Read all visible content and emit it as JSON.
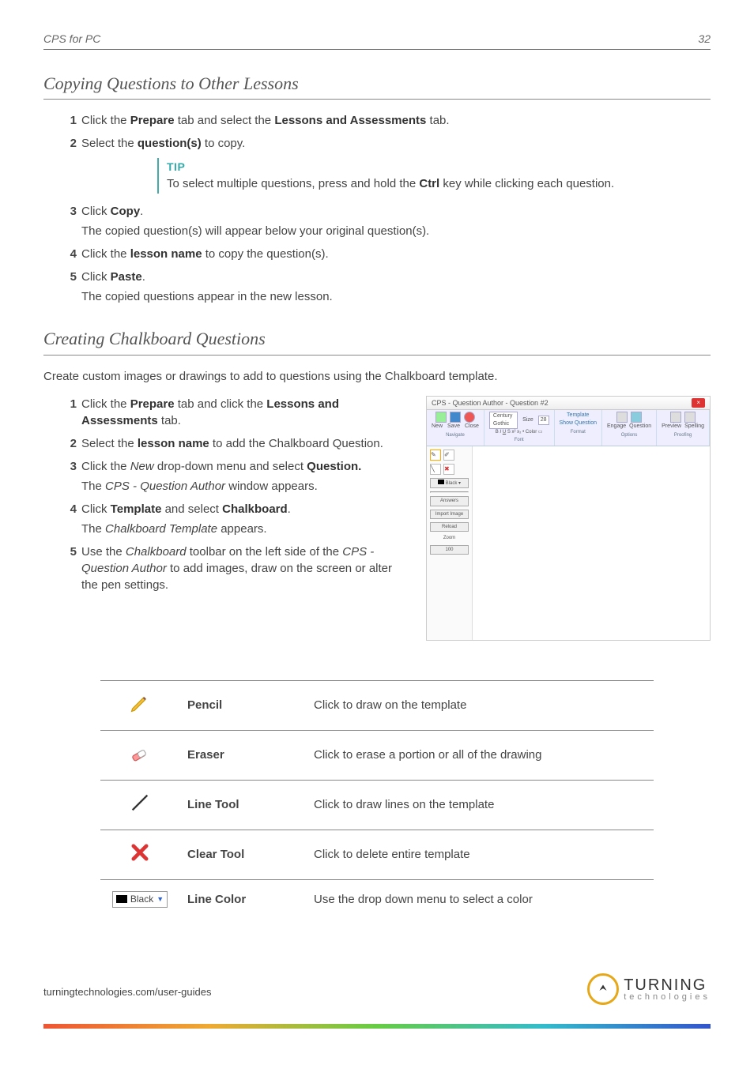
{
  "header": {
    "doc_title": "CPS for PC",
    "page_num": "32"
  },
  "section1": {
    "title": "Copying Questions to Other Lessons",
    "steps": [
      {
        "num": "1",
        "html": "Click the <b>Prepare</b> tab and select the <b>Lessons and Assessments</b> tab."
      },
      {
        "num": "2",
        "html": "Select the <b>question(s)</b> to copy."
      },
      {
        "num": "3",
        "html": "Click <b>Copy</b>.",
        "sub": "The copied question(s) will appear below your original question(s)."
      },
      {
        "num": "4",
        "html": "Click the <b>lesson name</b> to copy the question(s)."
      },
      {
        "num": "5",
        "html": "Click <b>Paste</b>.",
        "sub": "The copied questions appear in the new lesson."
      }
    ],
    "tip": {
      "title": "TIP",
      "html": "To select multiple questions, press and hold the <b>Ctrl</b> key while clicking each question."
    }
  },
  "section2": {
    "title": "Creating Chalkboard Questions",
    "intro": "Create custom images or drawings to add to questions using the Chalkboard template.",
    "steps": [
      {
        "num": "1",
        "html": "Click the <b>Prepare</b> tab and click the <b>Lessons and Assessments</b> tab."
      },
      {
        "num": "2",
        "html": "Select the <b>lesson name</b> to add the Chalkboard Question."
      },
      {
        "num": "3",
        "html": "Click the <em>New</em> drop-down menu and select <b>Question.</b>",
        "sub": "The <em>CPS - Question Author</em> window appears."
      },
      {
        "num": "4",
        "html": "Click <b>Template</b> and select <b>Chalkboard</b>.",
        "sub": "The <em>Chalkboard Template</em> appears."
      },
      {
        "num": "5",
        "html": "Use the <em>Chalkboard</em> toolbar on the left side of the <em>CPS - Question Author</em> to add images, draw on the screen or alter the pen settings."
      }
    ]
  },
  "screenshot": {
    "window_title": "CPS - Question Author - Question #2",
    "ribbon": {
      "navigate": {
        "label": "Navigate",
        "items": [
          "New",
          "Save",
          "Close"
        ]
      },
      "font_group": {
        "label": "Font",
        "font_name": "Century Gothic",
        "size_label": "Size",
        "size_value": "28",
        "color_label": "Color"
      },
      "format": {
        "label": "Format",
        "template_label": "Template",
        "show_q": "Show Question"
      },
      "options": {
        "label": "Options",
        "items": [
          "Engage",
          "Question"
        ]
      },
      "proofing": {
        "label": "Proofing",
        "items": [
          "Preview",
          "Spelling"
        ]
      }
    },
    "side_tools": {
      "color_label": "Black",
      "answers_btn": "Answers",
      "import_btn": "Import Image",
      "reload_btn": "Reload",
      "zoom_label": "Zoom",
      "zoom_value": "100"
    }
  },
  "tools_table": [
    {
      "icon": "pencil",
      "name": "Pencil",
      "desc": "Click to draw on the template"
    },
    {
      "icon": "eraser",
      "name": "Eraser",
      "desc": "Click to erase a portion or all of the drawing"
    },
    {
      "icon": "line",
      "name": "Line Tool",
      "desc": "Click to draw lines on the template"
    },
    {
      "icon": "clear",
      "name": "Clear Tool",
      "desc": "Click to delete entire template"
    },
    {
      "icon": "color",
      "name": "Line Color",
      "desc": "Use the drop down menu to select a color",
      "color_text": "Black"
    }
  ],
  "footer": {
    "url": "turningtechnologies.com/user-guides",
    "logo_main": "TURNING",
    "logo_sub": "technologies"
  }
}
